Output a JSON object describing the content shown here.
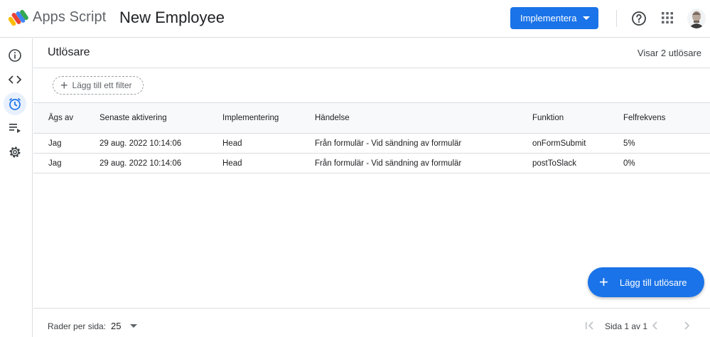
{
  "header": {
    "app_name": "Apps Script",
    "project_name": "New Employee",
    "deploy_label": "Implementera"
  },
  "icons": {
    "logo": "apps-script-logo",
    "help": "help-icon",
    "apps": "apps-grid-icon",
    "avatar": "avatar"
  },
  "colors": {
    "accent": "#1a73e8",
    "border": "#dadce0",
    "active_nav_bg": "#e8f0fe"
  },
  "nav": {
    "items": [
      {
        "icon": "info-icon"
      },
      {
        "icon": "code-editor-icon"
      },
      {
        "icon": "triggers-clock-icon",
        "active": true
      },
      {
        "icon": "executions-icon"
      },
      {
        "icon": "settings-gear-icon"
      }
    ]
  },
  "page": {
    "title": "Utlösare",
    "showing": "Visar 2 utlösare",
    "filter_label": "Lägg till ett filter"
  },
  "table": {
    "headers": [
      "Ägs av",
      "Senaste aktivering",
      "Implementering",
      "Händelse",
      "Funktion",
      "Felfrekvens"
    ],
    "rows": [
      [
        "Jag",
        "29 aug. 2022 10:14:06",
        "Head",
        "Från formulär - Vid sändning av formulär",
        "onFormSubmit",
        "5%"
      ],
      [
        "Jag",
        "29 aug. 2022 10:14:06",
        "Head",
        "Från formulär - Vid sändning av formulär",
        "postToSlack",
        "0%"
      ]
    ]
  },
  "fab_label": "Lägg till utlösare",
  "footer": {
    "rows_per_page_label": "Rader per sida:",
    "rows_per_page_value": "25",
    "page_info": "Sida 1 av 1"
  }
}
